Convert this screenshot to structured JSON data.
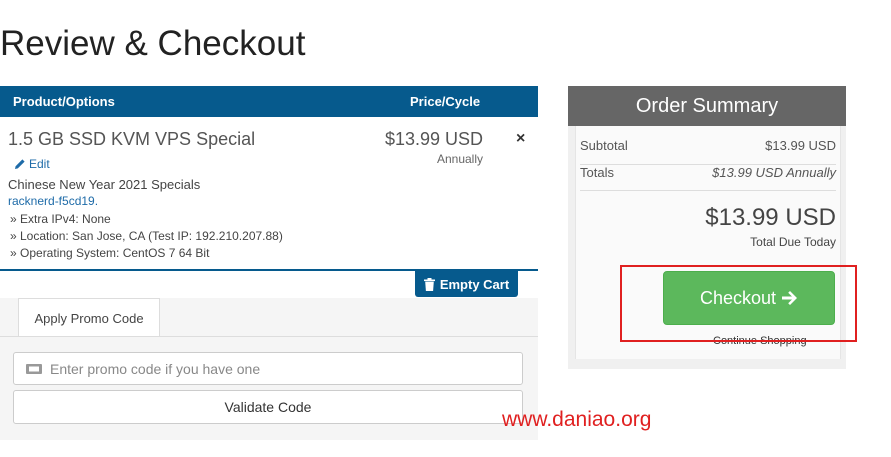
{
  "page": {
    "title": "Review & Checkout"
  },
  "cart": {
    "header": {
      "product": "Product/Options",
      "price": "Price/Cycle"
    },
    "item": {
      "name": "1.5 GB SSD KVM VPS Special",
      "price": "$13.99 USD",
      "cycle": "Annually",
      "edit_label": "Edit",
      "group": "Chinese New Year 2021 Specials",
      "hostname": "racknerd-f5cd19",
      "options": [
        "» Extra IPv4: None",
        "» Location: San Jose, CA (Test IP: 192.210.207.88)",
        "» Operating System: CentOS 7 64 Bit"
      ]
    },
    "empty_cart_label": "Empty Cart"
  },
  "promo": {
    "tab_label": "Apply Promo Code",
    "placeholder": "Enter promo code if you have one",
    "value": "",
    "validate_label": "Validate Code"
  },
  "summary": {
    "title": "Order Summary",
    "subtotal_label": "Subtotal",
    "subtotal_value": "$13.99 USD",
    "totals_label": "Totals",
    "totals_value": "$13.99 USD Annually",
    "total_amount": "$13.99 USD",
    "total_label": "Total Due Today",
    "checkout_label": "Checkout",
    "continue_label": "Continue Shopping"
  },
  "watermark": "www.daniao.org",
  "colors": {
    "header_blue": "#065a8d",
    "summary_grey": "#666666",
    "checkout_green": "#5cb85c",
    "highlight_red": "#e02020"
  }
}
